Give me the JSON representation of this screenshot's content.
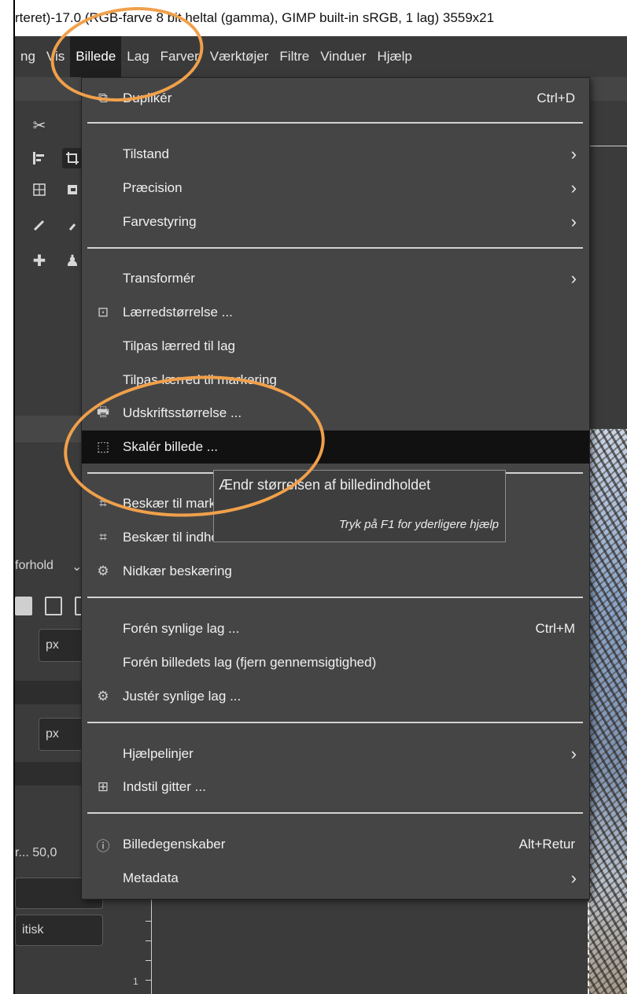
{
  "title_text": "rteret)-17.0 (RGB-farve 8 bit heltal (gamma), GIMP built-in sRGB, 1 lag) 3559x21 ",
  "menubar": {
    "items": [
      {
        "label": "ng"
      },
      {
        "label": "Vis"
      },
      {
        "label": "Billede"
      },
      {
        "label": "Lag"
      },
      {
        "label": "Farver"
      },
      {
        "label": "Værktøjer"
      },
      {
        "label": "Filtre"
      },
      {
        "label": "Vinduer"
      },
      {
        "label": "Hjælp"
      }
    ]
  },
  "menu": {
    "duplicate": {
      "label": "Duplikér",
      "shortcut": "Ctrl+D"
    },
    "mode": {
      "label": "Tilstand"
    },
    "precision": {
      "label": "Præcision"
    },
    "color_mgmt": {
      "label": "Farvestyring"
    },
    "transform": {
      "label": "Transformér"
    },
    "canvas_size": {
      "label": "Lærredstørrelse ..."
    },
    "fit_canvas_layers": {
      "label": "Tilpas lærred til lag"
    },
    "fit_canvas_selection": {
      "label": "Tilpas lærred til markering"
    },
    "print_size": {
      "label": "Udskriftsstørrelse ..."
    },
    "scale_image": {
      "label": "Skalér billede ..."
    },
    "crop_selection": {
      "label": "Beskær til markering"
    },
    "crop_content": {
      "label": "Beskær til indhold"
    },
    "zealous_crop": {
      "label": "Nidkær beskæring"
    },
    "merge_visible": {
      "label": "Forén synlige lag ...",
      "shortcut": "Ctrl+M"
    },
    "flatten": {
      "label": "Forén billedets lag (fjern gennemsigtighed)"
    },
    "align_visible": {
      "label": "Justér synlige lag ..."
    },
    "guides": {
      "label": "Hjælpelinjer"
    },
    "configure_grid": {
      "label": "Indstil gitter ..."
    },
    "properties": {
      "label": "Billedegenskaber",
      "shortcut": "Alt+Retur"
    },
    "metadata": {
      "label": "Metadata"
    }
  },
  "tooltip": {
    "main": "Ændr størrelsen af billedindholdet",
    "hint": "Tryk på F1 for yderligere hjælp"
  },
  "tool_options": {
    "ratio_label": "forhold",
    "unit1": "px",
    "unit2": "px",
    "zoom_value": "r... 50,0",
    "auto_label": "itisk"
  },
  "ruler_label": "1",
  "colors": {
    "annotation": "#f0a04b",
    "menu_bg": "#454545",
    "highlight": "#111111"
  }
}
